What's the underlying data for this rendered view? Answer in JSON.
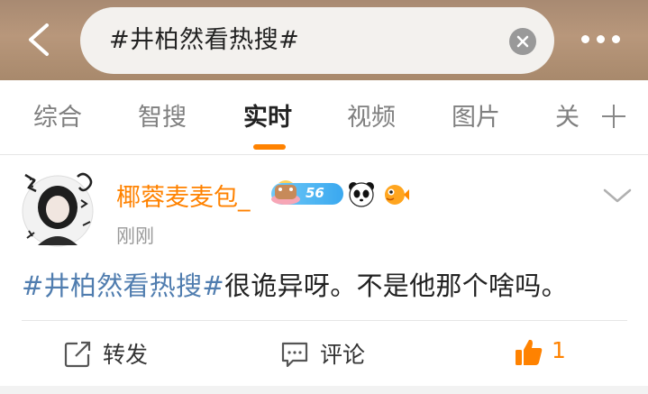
{
  "header": {
    "search_query": "#井柏然看热搜#"
  },
  "tabs": [
    {
      "label": "综合",
      "active": false
    },
    {
      "label": "智搜",
      "active": false
    },
    {
      "label": "实时",
      "active": true
    },
    {
      "label": "视频",
      "active": false
    },
    {
      "label": "图片",
      "active": false
    },
    {
      "label": "关",
      "active": false
    }
  ],
  "post": {
    "username": "椰蓉麦麦包_",
    "level": "56",
    "timestamp": "刚刚",
    "hashtag": "#井柏然看热搜#",
    "text": "很诡异呀。不是他那个啥吗。"
  },
  "actions": {
    "repost_label": "转发",
    "comment_label": "评论",
    "like_count": "1"
  },
  "colors": {
    "accent": "#ff8200",
    "hashtag": "#507daf",
    "header_bg": "#b0917a"
  },
  "icons": [
    "back-arrow-icon",
    "clear-icon",
    "more-icon",
    "plus-icon",
    "chevron-down-icon",
    "repost-icon",
    "comment-icon",
    "thumbs-up-icon"
  ]
}
